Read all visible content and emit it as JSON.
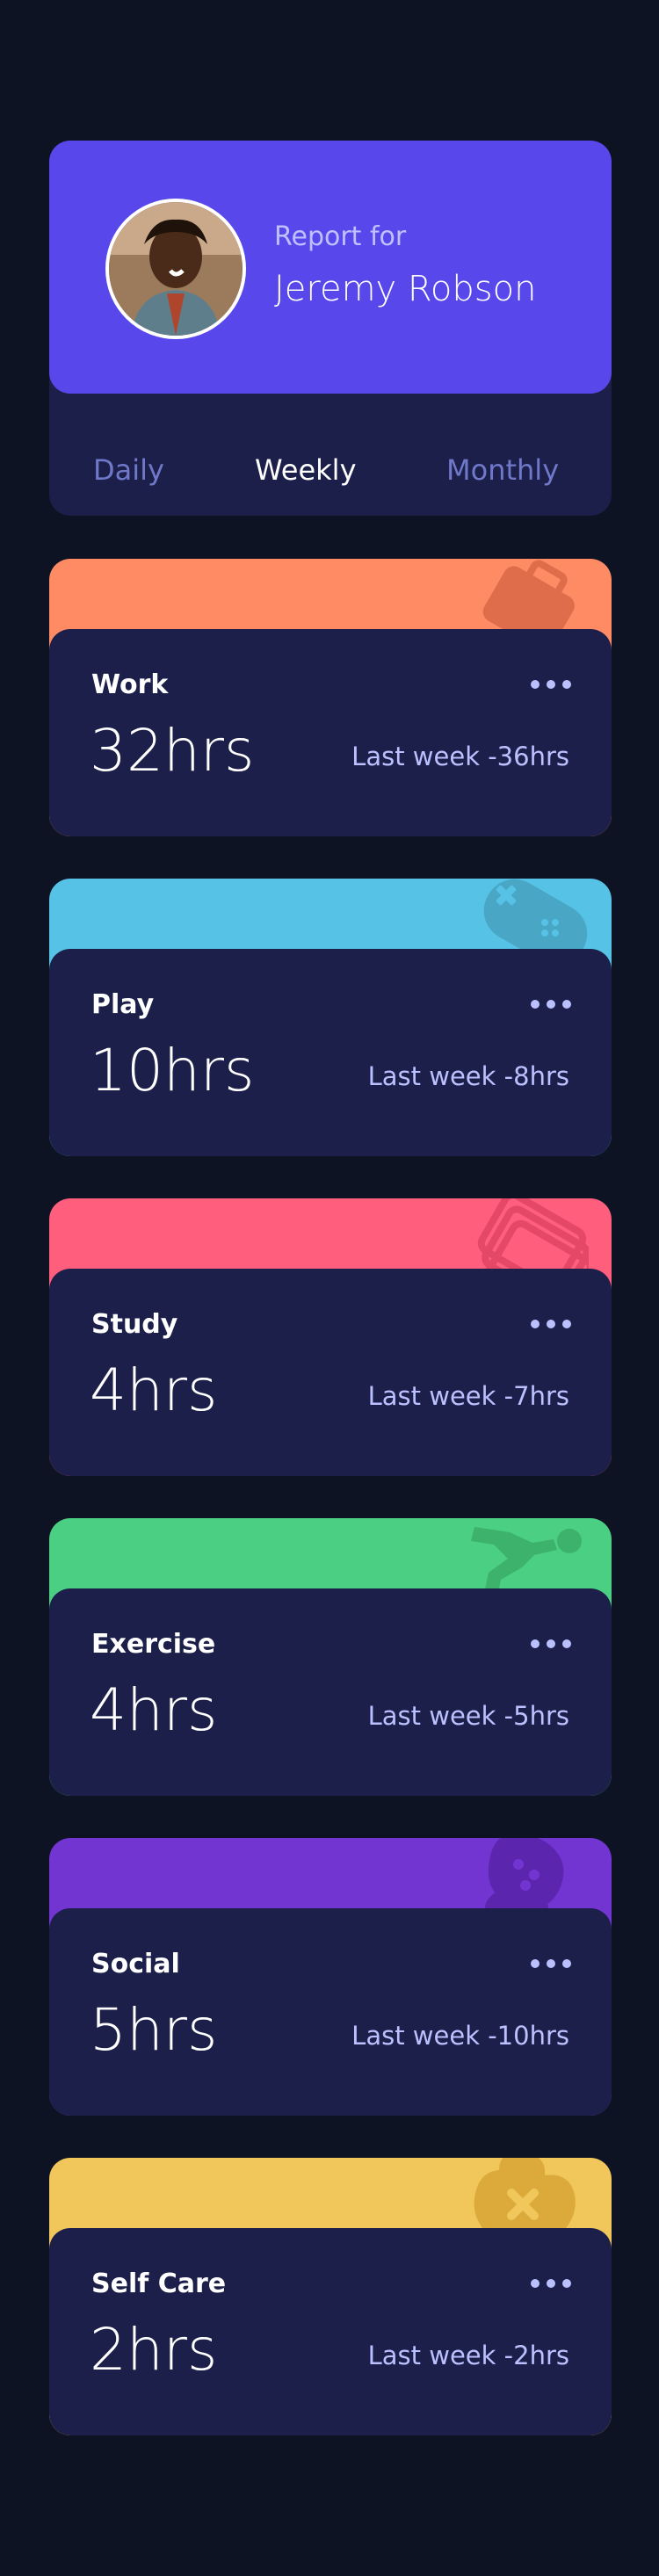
{
  "profile": {
    "report_for": "Report for",
    "name": "Jeremy Robson"
  },
  "tabs": [
    {
      "label": "Daily",
      "active": false
    },
    {
      "label": "Weekly",
      "active": true
    },
    {
      "label": "Monthly",
      "active": false
    }
  ],
  "cards": [
    {
      "title": "Work",
      "current": "32hrs",
      "previous": "Last week -36hrs",
      "color": "#ff8b64",
      "icon": "briefcase-icon"
    },
    {
      "title": "Play",
      "current": "10hrs",
      "previous": "Last week -8hrs",
      "color": "#55c2e6",
      "icon": "gamepad-icon"
    },
    {
      "title": "Study",
      "current": "4hrs",
      "previous": "Last week -7hrs",
      "color": "#ff5e7d",
      "icon": "book-icon"
    },
    {
      "title": "Exercise",
      "current": "4hrs",
      "previous": "Last week -5hrs",
      "color": "#4bcf82",
      "icon": "running-icon"
    },
    {
      "title": "Social",
      "current": "5hrs",
      "previous": "Last week -10hrs",
      "color": "#7335d2",
      "icon": "chat-icon"
    },
    {
      "title": "Self Care",
      "current": "2hrs",
      "previous": "Last week -2hrs",
      "color": "#f1c75b",
      "icon": "heart-icon"
    }
  ],
  "colors": {
    "background": "#0e1323",
    "card": "#1c1f4a",
    "profile": "#5847eb",
    "muted": "#7078c9",
    "pale": "#bbc0ff"
  }
}
